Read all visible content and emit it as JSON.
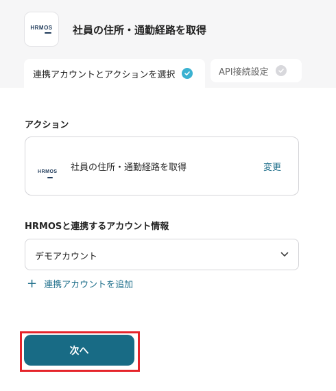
{
  "header": {
    "logo_text": "HRMOS",
    "action_title": "社員の住所・通勤経路を取得"
  },
  "tabs": [
    {
      "label": "連携アカウントとアクションを選択",
      "status": "complete"
    },
    {
      "label": "API接続設定",
      "status": "incomplete"
    }
  ],
  "action_section": {
    "label": "アクション",
    "card": {
      "logo_text": "HRMOS",
      "action_name": "社員の住所・通勤経路を取得",
      "change_label": "変更"
    }
  },
  "account_section": {
    "label": "HRMOSと連携するアカウント情報",
    "selected_account": "デモアカウント",
    "add_account_label": "連携アカウントを追加"
  },
  "footer": {
    "next_label": "次へ"
  },
  "colors": {
    "accent": "#186b85",
    "link": "#1f6f8b",
    "check_active": "#3bb2d1",
    "highlight_frame": "#e5242b"
  }
}
